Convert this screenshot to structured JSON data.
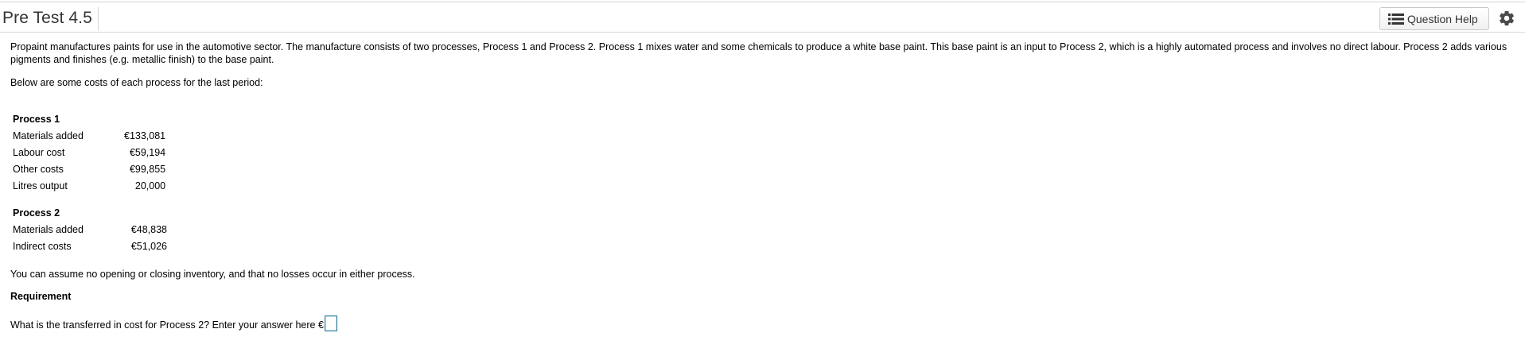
{
  "header": {
    "title": "Pre Test 4.5",
    "help_label": "Question Help"
  },
  "question": {
    "intro": "Propaint manufactures paints for use in the automotive sector. The manufacture consists of two processes, Process 1 and Process 2. Process 1 mixes water and some chemicals to produce a white base paint. This base paint is an input to Process 2, which is a highly  automated process and involves no direct labour. Process 2 adds various pigments and finishes (e.g. metallic finish) to the base paint.",
    "below_text": "Below are some costs of each process for the last period:",
    "process1": {
      "heading": "Process 1",
      "rows": [
        {
          "label": "Materials added",
          "value": "€133,081"
        },
        {
          "label": "Labour cost",
          "value": "€59,194"
        },
        {
          "label": "Other costs",
          "value": "€99,855"
        },
        {
          "label": "Litres output",
          "value": "20,000"
        }
      ]
    },
    "process2": {
      "heading": "Process 2",
      "rows": [
        {
          "label": "Materials added",
          "value": "€48,838"
        },
        {
          "label": "Indirect costs",
          "value": "€51,026"
        }
      ]
    },
    "assumption": "You can assume no opening or closing inventory, and that no losses occur in either process.",
    "requirement_heading": "Requirement",
    "prompt": "What is the transferred in cost for Process 2?  Enter your answer here €",
    "answer_value": ""
  },
  "icons": {
    "help": "list-icon",
    "settings": "gear-icon"
  }
}
